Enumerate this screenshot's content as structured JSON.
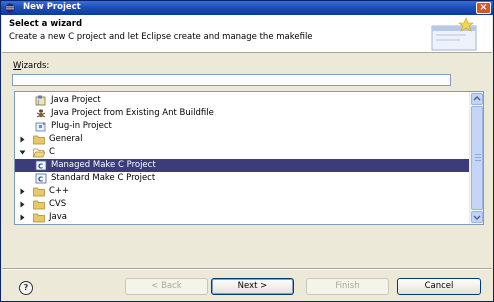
{
  "window": {
    "title": "New Project",
    "close_glyph": "×"
  },
  "banner": {
    "title": "Select a wizard",
    "description": "Create a new C project and let Eclipse create and manage the makefile"
  },
  "filter": {
    "label_mnemonic": "W",
    "label_rest": "izards:",
    "value": ""
  },
  "tree": {
    "items": [
      {
        "label": "Java Project",
        "icon": "java-project-icon",
        "indent": 1,
        "expander": "none",
        "selected": false
      },
      {
        "label": "Java Project from Existing Ant Buildfile",
        "icon": "ant-project-icon",
        "indent": 1,
        "expander": "none",
        "selected": false
      },
      {
        "label": "Plug-in Project",
        "icon": "plugin-project-icon",
        "indent": 1,
        "expander": "none",
        "selected": false
      },
      {
        "label": "General",
        "icon": "folder-icon",
        "indent": 0,
        "expander": "collapsed",
        "selected": false
      },
      {
        "label": "C",
        "icon": "folder-open-icon",
        "indent": 0,
        "expander": "expanded",
        "selected": false
      },
      {
        "label": "Managed Make C Project",
        "icon": "c-project-icon",
        "indent": 1,
        "expander": "none",
        "selected": true
      },
      {
        "label": "Standard Make C Project",
        "icon": "c-project-icon",
        "indent": 1,
        "expander": "none",
        "selected": false
      },
      {
        "label": "C++",
        "icon": "folder-icon",
        "indent": 0,
        "expander": "collapsed",
        "selected": false
      },
      {
        "label": "CVS",
        "icon": "folder-icon",
        "indent": 0,
        "expander": "collapsed",
        "selected": false
      },
      {
        "label": "Java",
        "icon": "folder-icon",
        "indent": 0,
        "expander": "collapsed",
        "selected": false
      }
    ]
  },
  "buttons": {
    "help": "?",
    "back": "< Back",
    "next": "Next >",
    "finish": "Finish",
    "cancel": "Cancel"
  },
  "colors": {
    "selection": "#3c3c7a",
    "titlebar": "#1e4fb8",
    "folder": "#e8c867"
  }
}
